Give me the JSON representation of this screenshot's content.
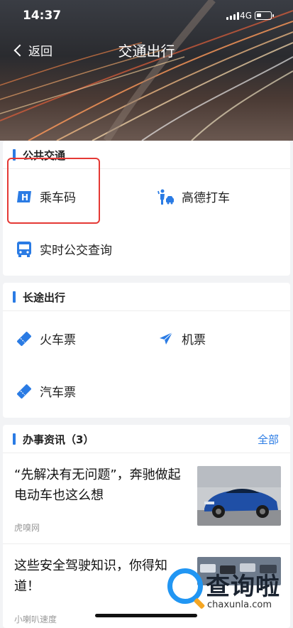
{
  "status_bar": {
    "time": "14:37",
    "network": "4G"
  },
  "nav": {
    "back_label": "返回",
    "title": "交通出行"
  },
  "public_transit": {
    "title": "公共交通",
    "items": [
      {
        "label": "乘车码",
        "icon": "h-card-icon"
      },
      {
        "label": "高德打车",
        "icon": "taxi-person-icon"
      },
      {
        "label": "实时公交查询",
        "icon": "bus-icon"
      }
    ]
  },
  "long_distance": {
    "title": "长途出行",
    "items": [
      {
        "label": "火车票",
        "icon": "ticket-icon"
      },
      {
        "label": "机票",
        "icon": "airplane-icon"
      },
      {
        "label": "汽车票",
        "icon": "ticket-icon"
      }
    ]
  },
  "news": {
    "title": "办事资讯（3）",
    "more_label": "全部",
    "items": [
      {
        "headline": "“先解决有无问题”，奔驰做起电动车也这么想",
        "source": "虎嗅网"
      },
      {
        "headline": "这些安全驾驶知识，你得知道！",
        "source": "小喇叭速度"
      }
    ]
  },
  "watermark": {
    "brand": "查询啦",
    "url": "chaxunla.com"
  },
  "colors": {
    "accent": "#2a7be4",
    "highlight": "#e53935"
  }
}
